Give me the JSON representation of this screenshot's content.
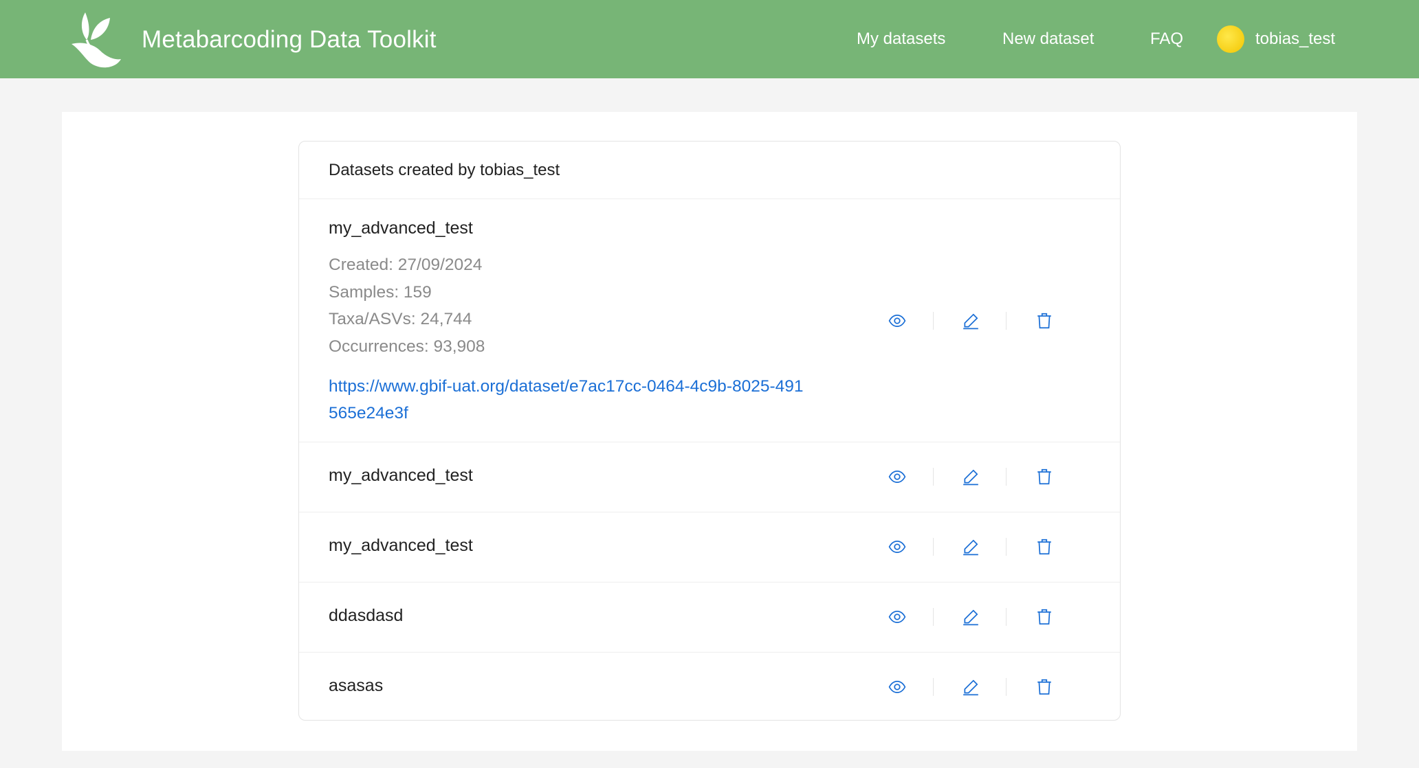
{
  "header": {
    "app_title": "Metabarcoding Data Toolkit",
    "logo_icon": "leaf-logo-icon",
    "nav": [
      {
        "label": "My datasets"
      },
      {
        "label": "New dataset"
      },
      {
        "label": "FAQ"
      }
    ],
    "user": {
      "name": "tobias_test",
      "avatar_color": "#f5cd14"
    }
  },
  "colors": {
    "header_bg": "#77b576",
    "link": "#1b6fd6",
    "action_icon": "#1b6fd6"
  },
  "card": {
    "title": "Datasets created by tobias_test",
    "datasets": [
      {
        "name": "my_advanced_test",
        "created": "Created: 27/09/2024",
        "samples": "Samples: 159",
        "taxa": "Taxa/ASVs: 24,744",
        "occurrences": "Occurrences: 93,908",
        "url": "https://www.gbif-uat.org/dataset/e7ac17cc-0464-4c9b-8025-491565e24e3f"
      },
      {
        "name": "my_advanced_test"
      },
      {
        "name": "my_advanced_test"
      },
      {
        "name": "ddasdasd"
      },
      {
        "name": "asasas"
      }
    ],
    "action_icons": [
      "eye-icon",
      "edit-icon",
      "trash-icon"
    ]
  }
}
